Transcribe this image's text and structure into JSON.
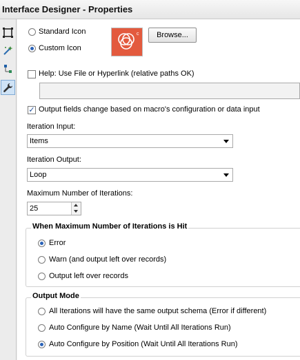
{
  "window": {
    "title": "Interface Designer - Properties"
  },
  "toolbar": {
    "items": [
      {
        "icon": "layout-icon"
      },
      {
        "icon": "wand-icon"
      },
      {
        "icon": "tree-icon"
      },
      {
        "icon": "wrench-icon",
        "active": true
      }
    ]
  },
  "icon_options": {
    "standard_label": "Standard Icon",
    "custom_label": "Custom Icon",
    "selected": "custom",
    "browse_label": "Browse...",
    "custom_icon_color": "#e35a3e"
  },
  "help": {
    "label": "Help: Use File or Hyperlink (relative paths OK)",
    "checked": false,
    "value": ""
  },
  "output_fields": {
    "label": "Output fields change based on macro's configuration or data input",
    "checked": true
  },
  "iteration_input": {
    "label": "Iteration Input:",
    "value": "Items"
  },
  "iteration_output": {
    "label": "Iteration Output:",
    "value": "Loop"
  },
  "max_iterations": {
    "label": "Maximum Number of Iterations:",
    "value": "25"
  },
  "max_hit_group": {
    "title": "When Maximum Number of Iterations is Hit",
    "options": [
      {
        "label": "Error",
        "selected": true
      },
      {
        "label": "Warn (and output left over records)",
        "selected": false
      },
      {
        "label": "Output left over records",
        "selected": false
      }
    ]
  },
  "output_mode_group": {
    "title": "Output Mode",
    "options": [
      {
        "label": "All Iterations will have the same output schema (Error if different)",
        "selected": false
      },
      {
        "label": "Auto Configure by Name (Wait Until All Iterations Run)",
        "selected": false
      },
      {
        "label": "Auto Configure by Position (Wait Until All Iterations Run)",
        "selected": true
      }
    ]
  }
}
